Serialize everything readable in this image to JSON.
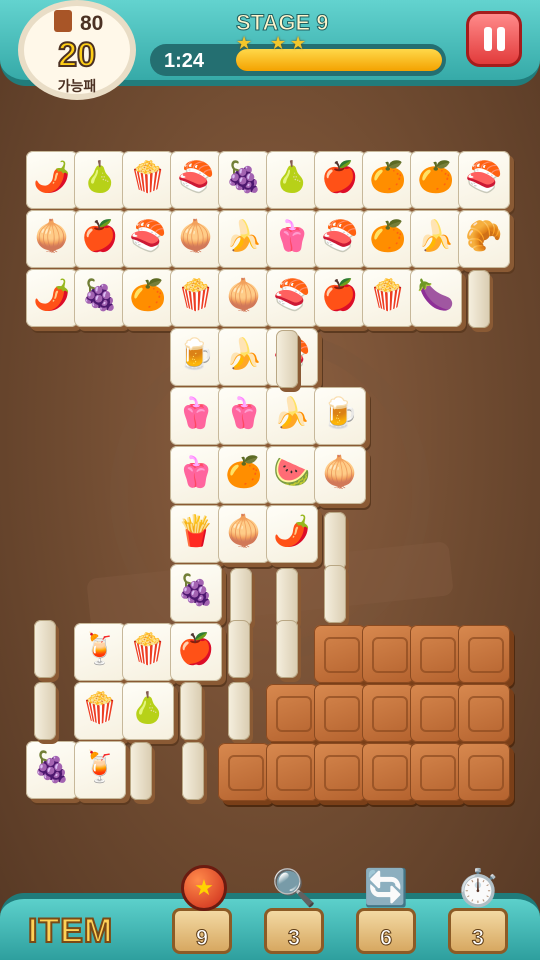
{
  "header": {
    "moves_top": "80",
    "moves_main": "20",
    "moves_sub": "가능패",
    "stage_title": "STAGE 9",
    "time": "1:24",
    "progress": 1.0,
    "stars": 3
  },
  "items": {
    "label": "ITEM",
    "list": [
      {
        "name": "bomb",
        "count": "9"
      },
      {
        "name": "magnifier",
        "count": "3"
      },
      {
        "name": "shuffle",
        "count": "6"
      },
      {
        "name": "stopwatch",
        "count": "3"
      }
    ]
  },
  "board": {
    "rows": [
      [
        "chili-pepper",
        "pear",
        "popcorn",
        "sushi-roll",
        "grapes",
        "pear",
        "apple",
        "orange",
        "orange",
        "sushi-roll"
      ],
      [
        "onion",
        "apple",
        "sushi-roll",
        "onion",
        "banana",
        "bell-pepper",
        "sushi-roll",
        "orange",
        "banana",
        "croissant"
      ],
      [
        "chili-pepper",
        "grapes",
        "orange",
        "popcorn",
        "onion",
        "sushi-roll",
        "apple",
        "popcorn",
        "eggplant"
      ],
      [
        "beer",
        "banana",
        "sushi-roll"
      ],
      [
        "bell-pepper",
        "bell-pepper",
        "banana",
        "beer"
      ],
      [
        "bell-pepper",
        "orange",
        "watermelon",
        "onion"
      ],
      [
        "fries",
        "onion",
        "chili-pepper"
      ],
      [
        "grapes"
      ],
      [
        "cocktail",
        "popcorn",
        "apple"
      ],
      [
        "popcorn",
        "pear"
      ],
      [
        "grapes",
        "cocktail"
      ]
    ],
    "blocked_tiles": 15
  }
}
